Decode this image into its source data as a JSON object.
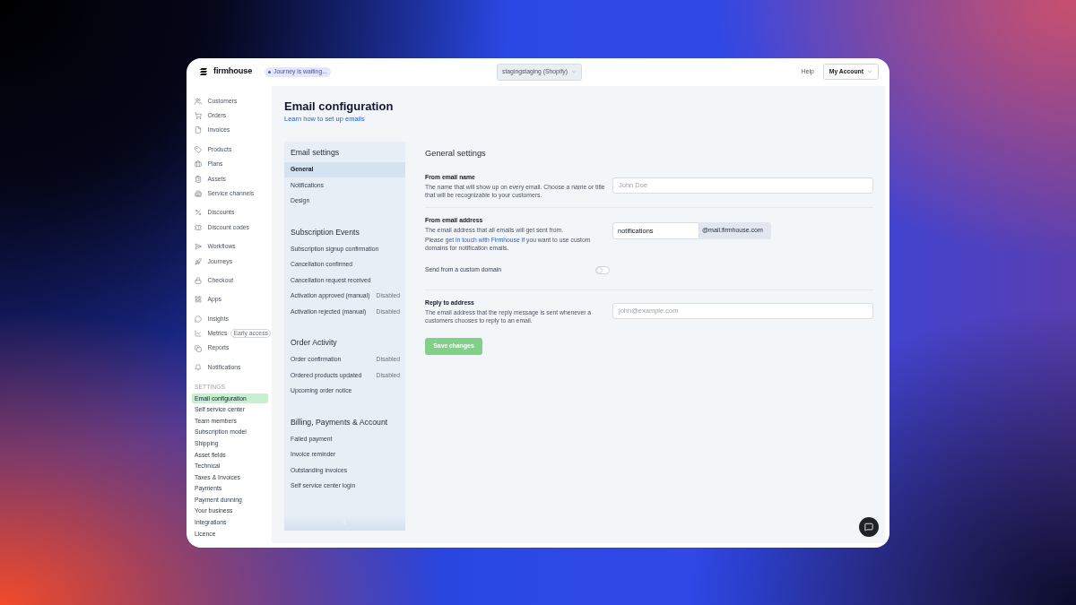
{
  "header": {
    "logo": "firmhouse",
    "status_badge": "Journey is waiting...",
    "store_select": "stagingstaging (Shopify)",
    "help_link": "Help",
    "account_menu": "My Account"
  },
  "sidebar": {
    "groups": [
      {
        "items": [
          {
            "label": "Customers",
            "selected": false
          },
          {
            "label": "Orders",
            "selected": false
          },
          {
            "label": "Invoices",
            "selected": false
          }
        ]
      },
      {
        "items": [
          {
            "label": "Products",
            "selected": false
          },
          {
            "label": "Plans",
            "selected": false
          },
          {
            "label": "Assets",
            "selected": false
          },
          {
            "label": "Service channels",
            "selected": false
          }
        ]
      },
      {
        "items": [
          {
            "label": "Discounts",
            "selected": false
          },
          {
            "label": "Discount codes",
            "selected": false
          }
        ]
      },
      {
        "items": [
          {
            "label": "Workflows",
            "selected": false
          },
          {
            "label": "Journeys",
            "selected": false
          }
        ]
      },
      {
        "items": [
          {
            "label": "Checkout",
            "selected": false
          }
        ]
      },
      {
        "items": [
          {
            "label": "Apps",
            "selected": false
          }
        ]
      },
      {
        "items": [
          {
            "label": "Insights",
            "selected": false
          },
          {
            "label": "Metrics",
            "selected": false,
            "badge": "Early access"
          },
          {
            "label": "Reports",
            "selected": false
          }
        ]
      },
      {
        "items": [
          {
            "label": "Notifications",
            "selected": false
          }
        ]
      }
    ],
    "settings": {
      "heading": "SETTINGS",
      "items": [
        {
          "label": "Email configuration",
          "selected": true
        },
        {
          "label": "Self service center",
          "selected": false
        },
        {
          "label": "Team members",
          "selected": false
        },
        {
          "label": "Subscription model",
          "selected": false
        },
        {
          "label": "Shipping",
          "selected": false
        },
        {
          "label": "Asset fields",
          "selected": false
        },
        {
          "label": "Technical",
          "selected": false
        },
        {
          "label": "Taxes & Invoices",
          "selected": false
        },
        {
          "label": "Payments",
          "selected": false
        },
        {
          "label": "Payment dunning",
          "selected": false
        },
        {
          "label": "Your business",
          "selected": false
        },
        {
          "label": "Integrations",
          "selected": false
        },
        {
          "label": "Licence",
          "selected": false
        }
      ]
    }
  },
  "page": {
    "title": "Email configuration",
    "help_link": "Learn how to set up emails"
  },
  "settings_nav": {
    "groups": [
      {
        "heading": "Email settings",
        "items": [
          {
            "label": "General",
            "selected": true
          },
          {
            "label": "Notifications",
            "selected": false
          },
          {
            "label": "Design",
            "selected": false
          }
        ]
      },
      {
        "heading": "Subscription Events",
        "items": [
          {
            "label": "Subscription signup confirmation",
            "selected": false
          },
          {
            "label": "Cancellation confirmed",
            "selected": false
          },
          {
            "label": "Cancellation request received",
            "selected": false
          },
          {
            "label": "Activation approved (manual)",
            "selected": false,
            "status": "Disabled"
          },
          {
            "label": "Activation rejected (manual)",
            "selected": false,
            "status": "Disabled"
          }
        ]
      },
      {
        "heading": "Order Activity",
        "items": [
          {
            "label": "Order confirmation",
            "selected": false,
            "status": "Disabled"
          },
          {
            "label": "Ordered products updated",
            "selected": false,
            "status": "Disabled"
          },
          {
            "label": "Upcoming order notice",
            "selected": false
          }
        ]
      },
      {
        "heading": "Billing, Payments & Account",
        "items": [
          {
            "label": "Failed payment",
            "selected": false
          },
          {
            "label": "Invoice reminder",
            "selected": false
          },
          {
            "label": "Outstanding invoices",
            "selected": false
          },
          {
            "label": "Self service center login",
            "selected": false
          }
        ]
      }
    ]
  },
  "form": {
    "title": "General settings",
    "fields": [
      {
        "kind": "text",
        "label": "From email name",
        "description": "The name that will show up on every email. Choose a name or title that will be recognizable to your customers.",
        "placeholder": "John Doe"
      },
      {
        "kind": "email_address",
        "label": "From email address",
        "description": "The email address that all emails will get sent from.",
        "note": {
          "before": "Please",
          "link": "get in touch with Firmhouse",
          "after": "if you want to use custom domains for notification emails."
        },
        "value": "notifications",
        "suffix": "@mail.firmhouse.com",
        "toggle": {
          "label": "Send from a custom domain",
          "on": false
        }
      },
      {
        "kind": "text",
        "label": "Reply to address",
        "description": "The email address that the reply message is sent whenever a customers chooses to reply to an email.",
        "placeholder": "john@example.com"
      }
    ],
    "save_button": {
      "label": "Save changes",
      "disabled": true
    }
  }
}
